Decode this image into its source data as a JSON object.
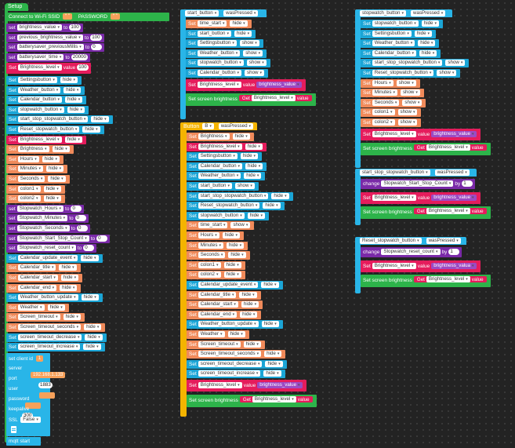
{
  "setup": {
    "hat": "Setup",
    "wifi": {
      "connect": "Connect to Wi-Fi SSID",
      "ssid_q": "“ ”",
      "password_label": "PASSWORD",
      "password_q": "“ ”"
    },
    "rows": [
      {
        "kind": "set-num",
        "color": "purple",
        "var": "brightness_value",
        "to": "to",
        "val": "100"
      },
      {
        "kind": "set-num",
        "color": "purple",
        "var": "previous_brightness_value",
        "to": "to",
        "val": "100"
      },
      {
        "kind": "set-num",
        "color": "purple",
        "var": "batterysaver_previousMillis",
        "to": "to",
        "val": "0"
      },
      {
        "kind": "set-num",
        "color": "purple",
        "var": "batterysaver_time",
        "to": "to",
        "val": "20000"
      },
      {
        "kind": "set-value",
        "color": "pink",
        "set": "Set",
        "var": "Brightness_level",
        "value": "value",
        "val": "100"
      },
      {
        "kind": "set-show",
        "color": "blue",
        "set": "Set",
        "var": "Settingsbutton",
        "state": "hide"
      },
      {
        "kind": "set-show",
        "color": "blue",
        "set": "Set",
        "var": "Weather_button",
        "state": "hide"
      },
      {
        "kind": "set-show",
        "color": "blue",
        "set": "Set",
        "var": "Calendar_button",
        "state": "hide"
      },
      {
        "kind": "set-show",
        "color": "blue",
        "set": "Set",
        "var": "stopwatch_button",
        "state": "hide"
      },
      {
        "kind": "set-show",
        "color": "blue",
        "set": "Set",
        "var": "start_stop_stopwatch_button",
        "state": "hide"
      },
      {
        "kind": "set-show",
        "color": "blue",
        "set": "Set",
        "var": "Reset_stopwatch_button",
        "state": "hide"
      },
      {
        "kind": "set-show",
        "color": "pink",
        "set": "Set",
        "var": "Brightness_level",
        "state": "hide"
      },
      {
        "kind": "set-show",
        "color": "orange",
        "set": "Set",
        "var": "Brightness",
        "state": "hide"
      },
      {
        "kind": "set-show",
        "color": "orange",
        "set": "Set",
        "var": "Hours",
        "state": "hide"
      },
      {
        "kind": "set-show",
        "color": "orange",
        "set": "Set",
        "var": "Minutes",
        "state": "hide"
      },
      {
        "kind": "set-show",
        "color": "orange",
        "set": "Set",
        "var": "Seconds",
        "state": "hide"
      },
      {
        "kind": "set-show",
        "color": "orange",
        "set": "Set",
        "var": "colon1",
        "state": "hide"
      },
      {
        "kind": "set-show",
        "color": "orange",
        "set": "Set",
        "var": "colon2",
        "state": "hide"
      },
      {
        "kind": "set-num",
        "color": "purple",
        "var": "Stopwatch_Hours",
        "to": "to",
        "val": "0"
      },
      {
        "kind": "set-num",
        "color": "purple",
        "var": "Stopwatch_Minutes",
        "to": "to",
        "val": "0"
      },
      {
        "kind": "set-num",
        "color": "purple",
        "var": "Stopwatch_Seconds",
        "to": "to",
        "val": "0"
      },
      {
        "kind": "set-num",
        "color": "purple",
        "var": "Stopwatch_Start_Stop_Count",
        "to": "to",
        "val": "0"
      },
      {
        "kind": "set-num",
        "color": "purple",
        "var": "Stopwatch_reset_count",
        "to": "to",
        "val": "0"
      },
      {
        "kind": "set-show",
        "color": "blue",
        "set": "Set",
        "var": "Calendar_update_event",
        "state": "hide"
      },
      {
        "kind": "set-show",
        "color": "orange",
        "set": "Set",
        "var": "Calendar_title",
        "state": "hide"
      },
      {
        "kind": "set-show",
        "color": "orange",
        "set": "Set",
        "var": "Calendar_start",
        "state": "hide"
      },
      {
        "kind": "set-show",
        "color": "orange",
        "set": "Set",
        "var": "Calendar_end",
        "state": "hide"
      },
      {
        "kind": "set-show",
        "color": "blue",
        "set": "Set",
        "var": "Weather_button_update",
        "state": "hide"
      },
      {
        "kind": "set-show",
        "color": "orange",
        "set": "Set",
        "var": "Weather",
        "state": "hide"
      },
      {
        "kind": "set-show",
        "color": "orange",
        "set": "Set",
        "var": "Screen_timeout",
        "state": "hide"
      },
      {
        "kind": "set-show",
        "color": "orange",
        "set": "Set",
        "var": "Screen_timeout_seconds",
        "state": "hide"
      },
      {
        "kind": "set-show",
        "color": "blue",
        "set": "Set",
        "var": "screen_timeout_decrease",
        "state": "hide"
      },
      {
        "kind": "set-show",
        "color": "blue",
        "set": "Set",
        "var": "screen_timeout_increase",
        "state": "hide"
      }
    ],
    "mqtt": {
      "client_label": "set client id",
      "client_val": "1",
      "server_label": "server",
      "server_val": "192.168.1.133",
      "port_label": "port",
      "port_val": "1883",
      "user_label": "user",
      "user_val": "",
      "password_label": "password",
      "password_val": "",
      "keepalive_label": "keepalive",
      "keepalive_val": "300",
      "ssl_label": "SSL",
      "ssl_val": "False",
      "start": "mqtt start"
    }
  },
  "start_button": {
    "hat_name": "start_button",
    "hat_event": "wasPressed",
    "rows": [
      {
        "kind": "set-show",
        "color": "orange",
        "set": "Set",
        "var": "time_start",
        "state": "hide"
      },
      {
        "kind": "set-show",
        "color": "blue",
        "set": "Set",
        "var": "start_button",
        "state": "hide"
      },
      {
        "kind": "set-show",
        "color": "blue",
        "set": "Set",
        "var": "Settingsbutton",
        "state": "show"
      },
      {
        "kind": "set-show",
        "color": "blue",
        "set": "Set",
        "var": "Weather_button",
        "state": "show"
      },
      {
        "kind": "set-show",
        "color": "blue",
        "set": "Set",
        "var": "stopwatch_button",
        "state": "show"
      },
      {
        "kind": "set-show",
        "color": "blue",
        "set": "Set",
        "var": "Calendar_button",
        "state": "show"
      },
      {
        "kind": "set-level",
        "set": "Set",
        "var": "Brightness_level",
        "value": "value",
        "get": "brightness_value"
      },
      {
        "kind": "screen",
        "label": "Set screen brightness",
        "get": "Get",
        "var": "Brightness_level",
        "value": "value"
      }
    ]
  },
  "button_b": {
    "hat_label": "Button",
    "hat_name": "B",
    "hat_event": "wasPressed",
    "rows": [
      {
        "kind": "set-show",
        "color": "orange",
        "set": "Set",
        "var": "Brightness",
        "state": "hide"
      },
      {
        "kind": "set-show",
        "color": "pink",
        "set": "Set",
        "var": "Brightness_level",
        "state": "hide"
      },
      {
        "kind": "set-show",
        "color": "blue",
        "set": "Set",
        "var": "Settingsbutton",
        "state": "hide"
      },
      {
        "kind": "set-show",
        "color": "blue",
        "set": "Set",
        "var": "Calendar_button",
        "state": "hide"
      },
      {
        "kind": "set-show",
        "color": "blue",
        "set": "Set",
        "var": "Weather_button",
        "state": "hide"
      },
      {
        "kind": "set-show",
        "color": "blue",
        "set": "Set",
        "var": "start_button",
        "state": "show"
      },
      {
        "kind": "set-show",
        "color": "blue",
        "set": "Set",
        "var": "start_stop_stopwatch_button",
        "state": "hide"
      },
      {
        "kind": "set-show",
        "color": "blue",
        "set": "Set",
        "var": "Reset_stopwatch_button",
        "state": "hide"
      },
      {
        "kind": "set-show",
        "color": "blue",
        "set": "Set",
        "var": "stopwatch_button",
        "state": "hide"
      },
      {
        "kind": "set-show",
        "color": "orange",
        "set": "Set",
        "var": "time_start",
        "state": "show"
      },
      {
        "kind": "set-show",
        "color": "orange",
        "set": "Set",
        "var": "Hours",
        "state": "hide"
      },
      {
        "kind": "set-show",
        "color": "orange",
        "set": "Set",
        "var": "Minutes",
        "state": "hide"
      },
      {
        "kind": "set-show",
        "color": "orange",
        "set": "Set",
        "var": "Seconds",
        "state": "hide"
      },
      {
        "kind": "set-show",
        "color": "orange",
        "set": "Set",
        "var": "colon1",
        "state": "hide"
      },
      {
        "kind": "set-show",
        "color": "orange",
        "set": "Set",
        "var": "colon2",
        "state": "hide"
      },
      {
        "kind": "set-show",
        "color": "blue",
        "set": "Set",
        "var": "Calendar_update_event",
        "state": "hide"
      },
      {
        "kind": "set-show",
        "color": "orange",
        "set": "Set",
        "var": "Calendar_title",
        "state": "hide"
      },
      {
        "kind": "set-show",
        "color": "orange",
        "set": "Set",
        "var": "Calendar_start",
        "state": "hide"
      },
      {
        "kind": "set-show",
        "color": "orange",
        "set": "Set",
        "var": "Calendar_end",
        "state": "hide"
      },
      {
        "kind": "set-show",
        "color": "blue",
        "set": "Set",
        "var": "Weather_button_update",
        "state": "hide"
      },
      {
        "kind": "set-show",
        "color": "orange",
        "set": "Set",
        "var": "Weather",
        "state": "hide"
      },
      {
        "kind": "set-show",
        "color": "orange",
        "set": "Set",
        "var": "Screen_timeout",
        "state": "hide"
      },
      {
        "kind": "set-show",
        "color": "orange",
        "set": "Set",
        "var": "Screen_timeout_seconds",
        "state": "hide"
      },
      {
        "kind": "set-show",
        "color": "blue",
        "set": "Set",
        "var": "screen_timeout_decrease",
        "state": "hide"
      },
      {
        "kind": "set-show",
        "color": "blue",
        "set": "Set",
        "var": "screen_timeout_increase",
        "state": "hide"
      },
      {
        "kind": "set-level",
        "set": "Set",
        "var": "Brightness_level",
        "value": "value",
        "get": "brightness_value"
      },
      {
        "kind": "screen",
        "label": "Set screen brightness",
        "get": "Get",
        "var": "Brightness_level",
        "value": "value"
      }
    ]
  },
  "stopwatch_button": {
    "hat_name": "stopwatch_button",
    "hat_event": "wasPressed",
    "rows": [
      {
        "kind": "set-show",
        "color": "blue",
        "set": "Set",
        "var": "stopwatch_button",
        "state": "hide"
      },
      {
        "kind": "set-show",
        "color": "blue",
        "set": "Set",
        "var": "Settingsbutton",
        "state": "hide"
      },
      {
        "kind": "set-show",
        "color": "blue",
        "set": "Set",
        "var": "Weather_button",
        "state": "hide"
      },
      {
        "kind": "set-show",
        "color": "blue",
        "set": "Set",
        "var": "Calendar_button",
        "state": "hide"
      },
      {
        "kind": "set-show",
        "color": "blue",
        "set": "Set",
        "var": "start_stop_stopwatch_button",
        "state": "show"
      },
      {
        "kind": "set-show",
        "color": "blue",
        "set": "Set",
        "var": "Reset_stopwatch_button",
        "state": "show"
      },
      {
        "kind": "set-show",
        "color": "orange",
        "set": "Set",
        "var": "Hours",
        "state": "show"
      },
      {
        "kind": "set-show",
        "color": "orange",
        "set": "Set",
        "var": "Minutes",
        "state": "show"
      },
      {
        "kind": "set-show",
        "color": "orange",
        "set": "Set",
        "var": "Seconds",
        "state": "show"
      },
      {
        "kind": "set-show",
        "color": "orange",
        "set": "Set",
        "var": "colon1",
        "state": "show"
      },
      {
        "kind": "set-show",
        "color": "orange",
        "set": "Set",
        "var": "colon2",
        "state": "show"
      },
      {
        "kind": "set-level",
        "set": "Set",
        "var": "Brightness_level",
        "value": "value",
        "get": "brightness_value"
      },
      {
        "kind": "screen",
        "label": "Set screen brightness",
        "get": "Get",
        "var": "Brightness_level",
        "value": "value"
      }
    ]
  },
  "start_stop": {
    "hat_name": "start_stop_stopwatch_button",
    "hat_event": "wasPressed",
    "rows": [
      {
        "kind": "change",
        "label": "change",
        "var": "Stopwatch_Start_Stop_Count",
        "by": "by",
        "val": "1"
      },
      {
        "kind": "set-level",
        "set": "Set",
        "var": "Brightness_level",
        "value": "value",
        "get": "brightness_value"
      },
      {
        "kind": "screen",
        "label": "Set screen brightness",
        "get": "Get",
        "var": "Brightness_level",
        "value": "value"
      }
    ]
  },
  "reset": {
    "hat_name": "Reset_stopwatch_button",
    "hat_event": "wasPressed",
    "rows": [
      {
        "kind": "change",
        "label": "change",
        "var": "Stopwatch_reset_count",
        "by": "by",
        "val": "1"
      },
      {
        "kind": "set-level",
        "set": "Set",
        "var": "Brightness_level",
        "value": "value",
        "get": "brightness_valua"
      },
      {
        "kind": "screen",
        "label": "Set screen brightness",
        "get": "Get",
        "var": "Brightness_level",
        "value": "value"
      }
    ]
  }
}
